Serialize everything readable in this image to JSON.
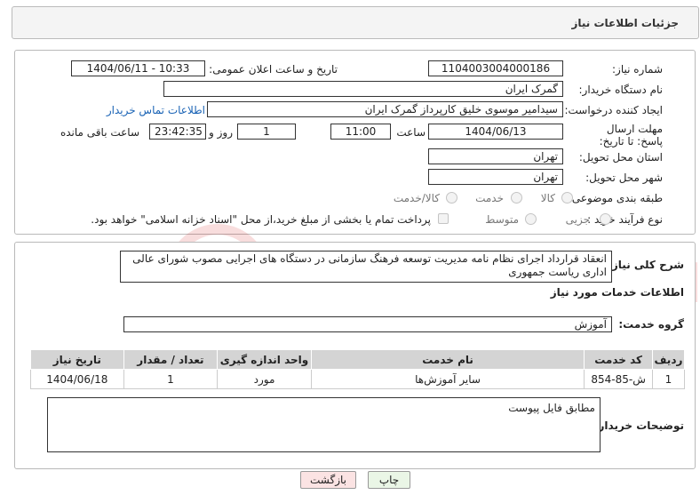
{
  "header": {
    "title": "جزئیات اطلاعات نیاز"
  },
  "form": {
    "need_number_label": "شماره نیاز:",
    "need_number": "1104003004000186",
    "announce_label": "تاریخ و ساعت اعلان عمومی:",
    "announce_value": "1404/06/11 - 10:33",
    "buyer_org_label": "نام دستگاه خریدار:",
    "buyer_org": "گمرک ایران",
    "requester_label": "ایجاد کننده درخواست:",
    "requester": "سیدامیر موسوی خلیق کارپرداز گمرک ایران",
    "contact_link": "اطلاعات تماس خریدار",
    "deadline_label": "مهلت ارسال پاسخ: تا تاریخ:",
    "deadline_date": "1404/06/13",
    "hour_label": "ساعت",
    "deadline_time": "11:00",
    "days_value": "1",
    "days_label": "روز و",
    "remaining_time": "23:42:35",
    "remaining_label": "ساعت باقی مانده",
    "province_label": "استان محل تحویل:",
    "province": "تهران",
    "city_label": "شهر محل تحویل:",
    "city": "تهران",
    "category_label": "طبقه بندی موضوعی:",
    "category_options": [
      "کالا",
      "خدمت",
      "کالا/خدمت"
    ],
    "process_label": "نوع فرآیند خرید :",
    "process_options": [
      "جزیی",
      "متوسط"
    ],
    "payment_note": "پرداخت تمام یا بخشی از مبلغ خرید،از محل \"اسناد خزانه اسلامی\" خواهد بود."
  },
  "description": {
    "label": "شرح کلی نیاز:",
    "text": "انعقاد قرارداد اجرای نظام نامه مدیریت توسعه فرهنگ سازمانی در دستگاه های اجرایی مصوب شورای عالی اداری ریاست جمهوری"
  },
  "services": {
    "section_title": "اطلاعات خدمات مورد نیاز",
    "group_label": "گروه خدمت:",
    "group_value": "آموزش",
    "columns": [
      "ردیف",
      "کد خدمت",
      "نام خدمت",
      "واحد اندازه گیری",
      "تعداد / مقدار",
      "تاریخ نیاز"
    ],
    "rows": [
      [
        "1",
        "ش-85-854",
        "سایر آموزش‌ها",
        "مورد",
        "1",
        "1404/06/18"
      ]
    ]
  },
  "buyer_notes": {
    "label": "توضیحات خریدار:",
    "text": "مطابق فایل پیوست"
  },
  "buttons": {
    "print": "چاپ",
    "back": "بازگشت"
  },
  "watermark": "AriaTender.neT"
}
